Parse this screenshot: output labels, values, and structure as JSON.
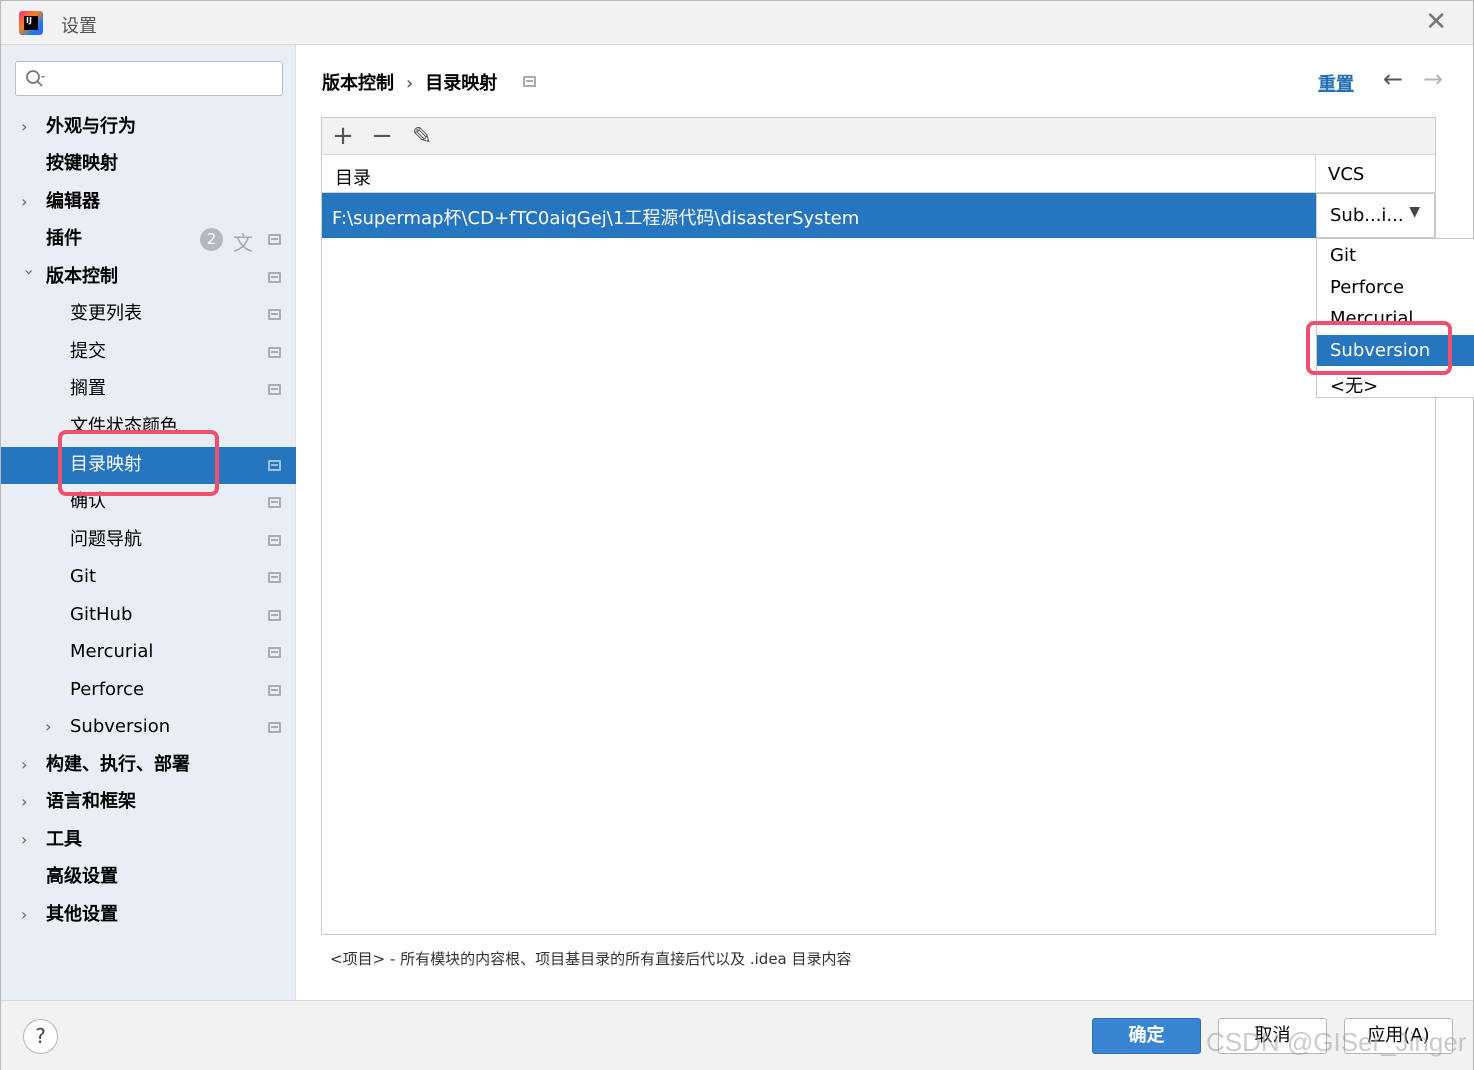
{
  "window": {
    "title": "设置",
    "app_icon_text": "IJ"
  },
  "sidebar": {
    "search_placeholder": "",
    "items": [
      {
        "label": "外观与行为",
        "expandable": true
      },
      {
        "label": "按键映射"
      },
      {
        "label": "编辑器",
        "expandable": true
      },
      {
        "label": "插件",
        "badge": "2"
      },
      {
        "label": "版本控制",
        "expanded": true
      },
      {
        "label": "变更列表"
      },
      {
        "label": "提交"
      },
      {
        "label": "搁置"
      },
      {
        "label": "文件状态颜色"
      },
      {
        "label": "目录映射",
        "selected": true
      },
      {
        "label": "确认"
      },
      {
        "label": "问题导航"
      },
      {
        "label": "Git"
      },
      {
        "label": "GitHub"
      },
      {
        "label": "Mercurial"
      },
      {
        "label": "Perforce"
      },
      {
        "label": "Subversion",
        "expandable": true
      },
      {
        "label": "构建、执行、部署",
        "expandable": true
      },
      {
        "label": "语言和框架",
        "expandable": true
      },
      {
        "label": "工具",
        "expandable": true
      },
      {
        "label": "高级设置"
      },
      {
        "label": "其他设置",
        "expandable": true
      }
    ]
  },
  "breadcrumb": {
    "parent": "版本控制",
    "separator": "›",
    "current": "目录映射"
  },
  "header": {
    "reset_label": "重置",
    "back_icon": "←",
    "forward_icon": "→"
  },
  "toolbar": {
    "add": "+",
    "remove": "−",
    "edit": "✎"
  },
  "table": {
    "columns": [
      "目录",
      "VCS"
    ],
    "rows": [
      {
        "directory": "F:\\supermap杯\\CD+fTC0aiqGej\\1工程源代码\\disasterSystem",
        "vcs": "Sub...i..."
      }
    ]
  },
  "dropdown": {
    "options": [
      "Git",
      "Perforce",
      "Mercurial",
      "Subversion",
      "<无>"
    ],
    "selected": "Subversion"
  },
  "hint": "<项目> - 所有模块的内容根、项目基目录的所有直接后代以及 .idea 目录内容",
  "footer": {
    "help": "?",
    "ok": "确定",
    "cancel": "取消",
    "apply": "应用(A)",
    "watermark": "CSDN @GISer_Jinger"
  },
  "colors": {
    "selection": "#2675bf",
    "highlight": "#f0506e",
    "link": "#2470b3"
  }
}
